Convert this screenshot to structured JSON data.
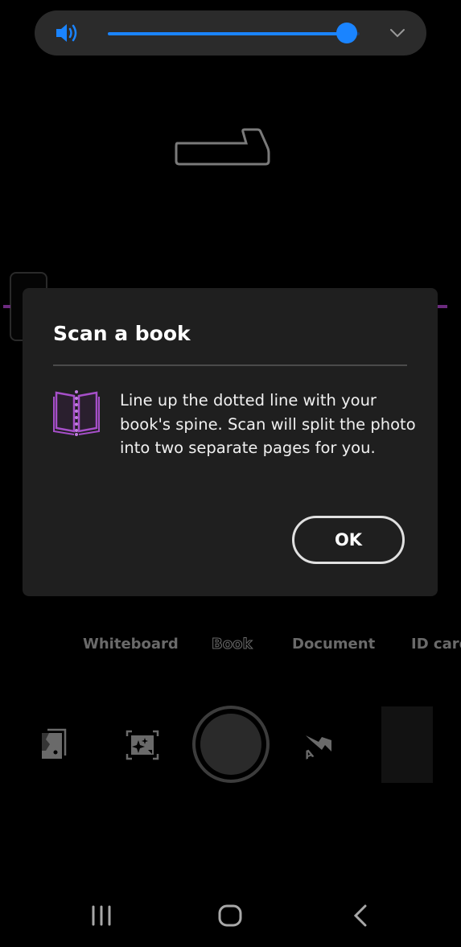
{
  "volume_panel": {
    "icon": "speaker-icon",
    "level_percent": 95,
    "accent_color": "#1a84ff",
    "expand_icon": "chevron-down-icon"
  },
  "dialog": {
    "title": "Scan a book",
    "icon": "open-book-icon",
    "icon_color": "#a64fc9",
    "body": "Line up the dotted line with your book's spine. Scan will split the photo into two separate pages for you.",
    "ok_label": "OK"
  },
  "modes": {
    "items": [
      {
        "label": "Whiteboard",
        "active": false
      },
      {
        "label": "Book",
        "active": true
      },
      {
        "label": "Document",
        "active": false
      },
      {
        "label": "ID card",
        "active": false
      }
    ]
  },
  "camera_controls": {
    "left1": "import-photos-icon",
    "left2": "auto-capture-icon",
    "shutter": "shutter-button",
    "flash": "flash-auto-icon",
    "flash_mode": "A",
    "thumbnail": "last-scan-thumbnail"
  },
  "navbar": {
    "recents": "recents-icon",
    "home": "home-icon",
    "back": "back-icon"
  }
}
